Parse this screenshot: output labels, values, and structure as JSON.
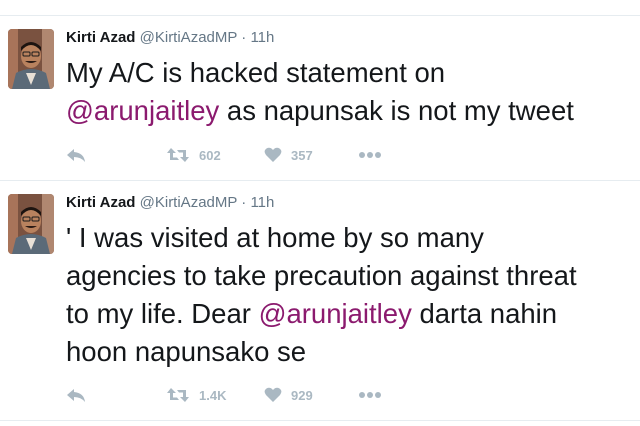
{
  "colors": {
    "mention": "#8b1a6e",
    "action_gray": "#aab8c2",
    "meta_gray": "#657786",
    "text": "#14171a"
  },
  "tweets": [
    {
      "author": "Kirti Azad",
      "handle": "@KirtiAzadMP",
      "separator": "·",
      "time": "11h",
      "lines": [
        {
          "parts": [
            {
              "text": "My A/C is hacked statement  on",
              "mention": false
            }
          ]
        },
        {
          "parts": [
            {
              "text": "@arunjaitley",
              "mention": true
            },
            {
              "text": " as napunsak is not my tweet",
              "mention": false
            }
          ]
        }
      ],
      "actions": {
        "reply_icon": "reply-icon",
        "retweet_icon": "retweet-icon",
        "retweet_count": "602",
        "like_icon": "heart-icon",
        "like_count": "357",
        "more_icon": "more-icon"
      }
    },
    {
      "author": "Kirti Azad",
      "handle": "@KirtiAzadMP",
      "separator": "·",
      "time": "11h",
      "lines": [
        {
          "parts": [
            {
              "text": "' I was visited at home by so many",
              "mention": false
            }
          ]
        },
        {
          "parts": [
            {
              "text": "agencies to take precaution against threat",
              "mention": false
            }
          ]
        },
        {
          "parts": [
            {
              "text": "to my life. Dear ",
              "mention": false
            },
            {
              "text": "@arunjaitley",
              "mention": true
            },
            {
              "text": "  darta nahin",
              "mention": false
            }
          ]
        },
        {
          "parts": [
            {
              "text": "hoon napunsako se",
              "mention": false
            }
          ]
        }
      ],
      "actions": {
        "reply_icon": "reply-icon",
        "retweet_icon": "retweet-icon",
        "retweet_count": "1.4K",
        "like_icon": "heart-icon",
        "like_count": "929",
        "more_icon": "more-icon"
      }
    }
  ]
}
